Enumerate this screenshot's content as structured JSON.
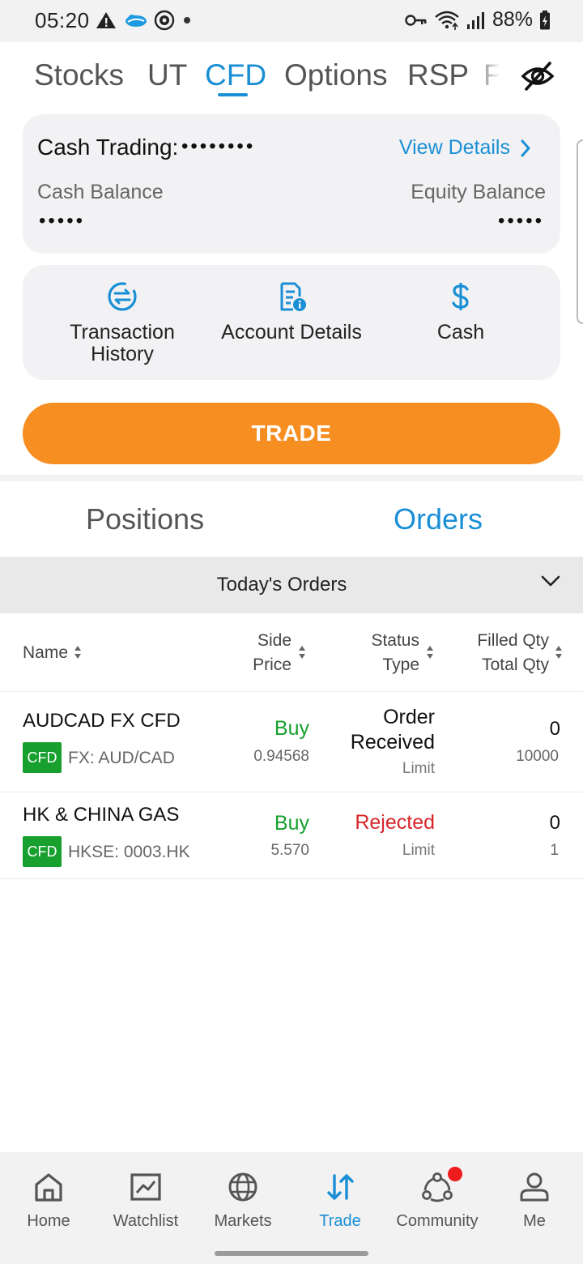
{
  "status_bar": {
    "time": "05:20",
    "battery": "88%",
    "icons_left": [
      "alert-icon",
      "cloud-icon",
      "compass-icon",
      "dot-icon"
    ],
    "icons_right": [
      "key-icon",
      "wifi-icon",
      "signal-icon",
      "battery-icon"
    ]
  },
  "tabs": {
    "items": [
      "Stocks",
      "UT",
      "CFD",
      "Options",
      "RSP",
      "F"
    ],
    "active": "CFD"
  },
  "cash_card": {
    "title": "Cash Trading:",
    "masked_account": "••••••••",
    "view_details": "View Details",
    "cash_balance_label": "Cash Balance",
    "equity_balance_label": "Equity Balance",
    "cash_balance_masked": "•••••",
    "equity_balance_masked": "•••••"
  },
  "quick_actions": [
    {
      "label": "Transaction History",
      "icon": "transfer-icon"
    },
    {
      "label": "Account Details",
      "icon": "document-info-icon"
    },
    {
      "label": "Cash",
      "icon": "dollar-icon"
    }
  ],
  "trade_button": "TRADE",
  "segments": {
    "positions": "Positions",
    "orders": "Orders",
    "active": "Orders"
  },
  "orders_filter": "Today's Orders",
  "table": {
    "headers": {
      "name": "Name",
      "side": "Side",
      "price": "Price",
      "status": "Status",
      "type": "Type",
      "filled_qty": "Filled Qty",
      "total_qty": "Total Qty"
    },
    "rows": [
      {
        "name": "AUDCAD FX CFD",
        "badge": "CFD",
        "market": "FX: AUD/CAD",
        "side": "Buy",
        "price": "0.94568",
        "status_line1": "Order",
        "status_line2": "Received",
        "type": "Limit",
        "filled_qty": "0",
        "total_qty": "10000"
      },
      {
        "name": "HK & CHINA GAS",
        "badge": "CFD",
        "market": "HKSE: 0003.HK",
        "side": "Buy",
        "price": "5.570",
        "status": "Rejected",
        "type": "Limit",
        "filled_qty": "0",
        "total_qty": "1"
      }
    ]
  },
  "bottom_nav": {
    "items": [
      "Home",
      "Watchlist",
      "Markets",
      "Trade",
      "Community",
      "Me"
    ],
    "active": "Trade"
  },
  "colors": {
    "accent_blue": "#1a8fd6",
    "trade_orange": "#f68e22",
    "buy_green": "#17a02e",
    "rejected_red": "#d7262b"
  }
}
